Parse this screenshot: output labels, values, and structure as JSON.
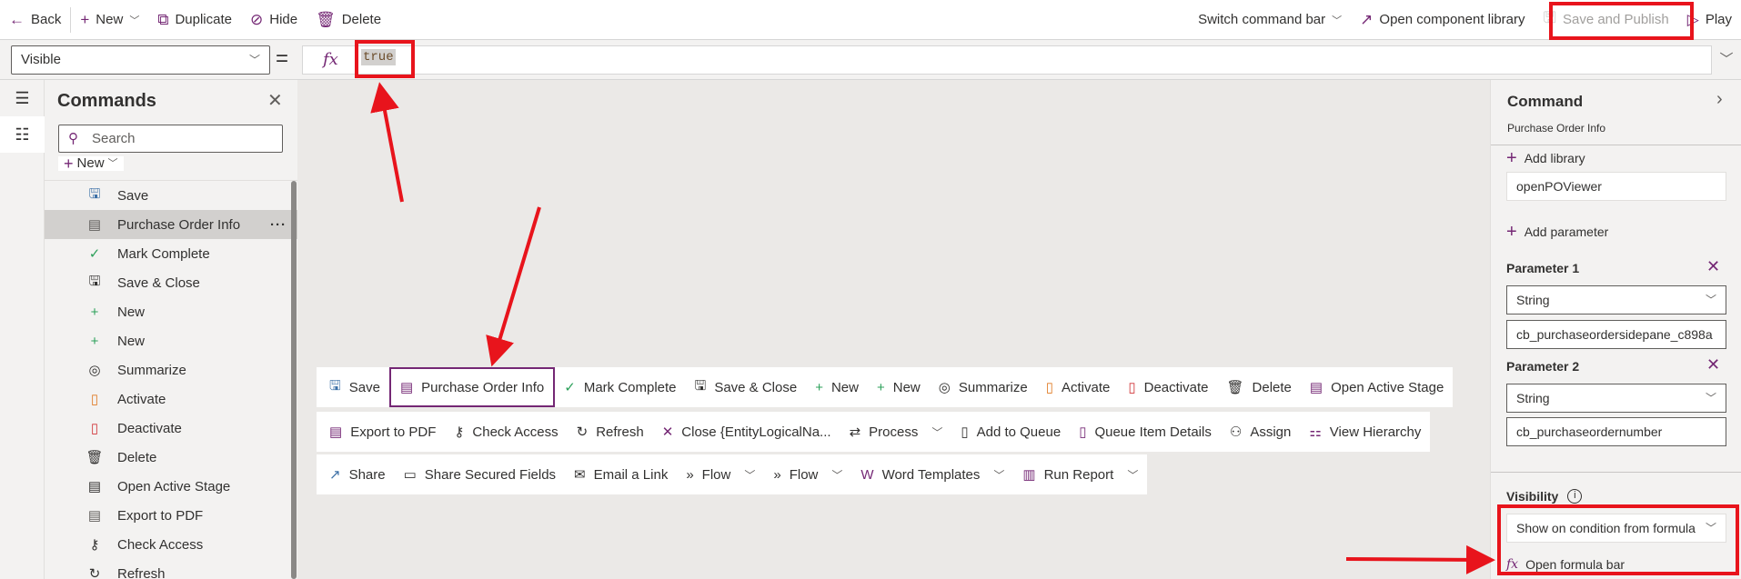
{
  "toolbar": {
    "left": [
      {
        "label": "Back",
        "icon": "back-arrow-icon",
        "glyph": "←"
      },
      {
        "label": "New",
        "icon": "plus-icon",
        "glyph": "+",
        "dropdown": true
      },
      {
        "label": "Duplicate",
        "icon": "duplicate-icon",
        "glyph": "⧉"
      },
      {
        "label": "Hide",
        "icon": "hide-eye-icon",
        "glyph": "⊘"
      },
      {
        "label": "Delete",
        "icon": "trash-icon",
        "glyph": "🗑"
      }
    ],
    "right": [
      {
        "label": "Switch command bar",
        "dropdown": true
      },
      {
        "label": "Open component library",
        "icon": "open-external-icon",
        "glyph": "↗"
      },
      {
        "label": "Save and Publish",
        "icon": "save-icon",
        "glyph": "🖫",
        "disabled": true
      },
      {
        "label": "Play",
        "icon": "play-icon",
        "glyph": "▷"
      }
    ]
  },
  "formula_bar": {
    "property": "Visible",
    "equals": "=",
    "fx": "fx",
    "value": "true"
  },
  "commands_panel": {
    "title": "Commands",
    "search_placeholder": "Search",
    "new_label": "New",
    "items": [
      {
        "label": "Save",
        "icon": "save-icon",
        "glyph": "🖫",
        "color": "#3b6fa6"
      },
      {
        "label": "Purchase Order Info",
        "icon": "pdf-icon",
        "glyph": "▤",
        "color": "#605e5c",
        "selected": true
      },
      {
        "label": "Mark Complete",
        "icon": "checkmark-icon",
        "glyph": "✓",
        "color": "#2ca05a"
      },
      {
        "label": "Save & Close",
        "icon": "save-close-icon",
        "glyph": "🖫",
        "color": "#323130"
      },
      {
        "label": "New",
        "icon": "plus-icon",
        "glyph": "+",
        "color": "#2ca05a"
      },
      {
        "label": "New",
        "icon": "plus-icon",
        "glyph": "+",
        "color": "#2ca05a"
      },
      {
        "label": "Summarize",
        "icon": "copilot-icon",
        "glyph": "◎",
        "color": "#323130"
      },
      {
        "label": "Activate",
        "icon": "activate-icon",
        "glyph": "▯",
        "color": "#e07b24"
      },
      {
        "label": "Deactivate",
        "icon": "deactivate-icon",
        "glyph": "▯",
        "color": "#d13438"
      },
      {
        "label": "Delete",
        "icon": "trash-icon",
        "glyph": "🗑",
        "color": "#323130"
      },
      {
        "label": "Open Active Stage",
        "icon": "stage-icon",
        "glyph": "▤",
        "color": "#323130"
      },
      {
        "label": "Export to PDF",
        "icon": "pdf-icon",
        "glyph": "▤",
        "color": "#605e5c"
      },
      {
        "label": "Check Access",
        "icon": "key-icon",
        "glyph": "⚷",
        "color": "#323130"
      },
      {
        "label": "Refresh",
        "icon": "refresh-icon",
        "glyph": "↻",
        "color": "#323130"
      }
    ]
  },
  "command_bar_preview": [
    [
      {
        "label": "Save",
        "icon": "save-icon",
        "glyph": "🖫",
        "color": "#3b6fa6"
      },
      {
        "label": "Purchase Order Info",
        "icon": "pdf-icon",
        "glyph": "▤",
        "color": "#742774",
        "selected": true
      },
      {
        "label": "Mark Complete",
        "icon": "checkmark-icon",
        "glyph": "✓",
        "color": "#2ca05a"
      },
      {
        "label": "Save & Close",
        "icon": "save-close-icon",
        "glyph": "🖫",
        "color": "#323130"
      },
      {
        "label": "New",
        "icon": "plus-icon",
        "glyph": "+",
        "color": "#2ca05a"
      },
      {
        "label": "New",
        "icon": "plus-icon",
        "glyph": "+",
        "color": "#2ca05a"
      },
      {
        "label": "Summarize",
        "icon": "copilot-icon",
        "glyph": "◎",
        "color": "#323130"
      },
      {
        "label": "Activate",
        "icon": "activate-icon",
        "glyph": "▯",
        "color": "#e07b24"
      },
      {
        "label": "Deactivate",
        "icon": "deactivate-icon",
        "glyph": "▯",
        "color": "#d13438"
      },
      {
        "label": "Delete",
        "icon": "trash-icon",
        "glyph": "🗑",
        "color": "#323130"
      },
      {
        "label": "Open Active Stage",
        "icon": "stage-icon",
        "glyph": "▤",
        "color": "#742774"
      }
    ],
    [
      {
        "label": "Export to PDF",
        "icon": "pdf-icon",
        "glyph": "▤",
        "color": "#742774"
      },
      {
        "label": "Check Access",
        "icon": "key-icon",
        "glyph": "⚷",
        "color": "#323130"
      },
      {
        "label": "Refresh",
        "icon": "refresh-icon",
        "glyph": "↻",
        "color": "#323130"
      },
      {
        "label": "Close {EntityLogicalNa...",
        "icon": "close-icon",
        "glyph": "✕",
        "color": "#742774"
      },
      {
        "label": "Process",
        "icon": "process-icon",
        "glyph": "⇄",
        "color": "#323130",
        "dropdown": true
      },
      {
        "label": "Add to Queue",
        "icon": "add-queue-icon",
        "glyph": "▯",
        "color": "#323130"
      },
      {
        "label": "Queue Item Details",
        "icon": "queue-details-icon",
        "glyph": "▯",
        "color": "#742774"
      },
      {
        "label": "Assign",
        "icon": "assign-icon",
        "glyph": "⚇",
        "color": "#323130"
      },
      {
        "label": "View Hierarchy",
        "icon": "hierarchy-icon",
        "glyph": "⚏",
        "color": "#742774"
      }
    ],
    [
      {
        "label": "Share",
        "icon": "share-icon",
        "glyph": "↗",
        "color": "#3b6fa6"
      },
      {
        "label": "Share Secured Fields",
        "icon": "secured-fields-icon",
        "glyph": "▭",
        "color": "#323130"
      },
      {
        "label": "Email a Link",
        "icon": "email-icon",
        "glyph": "✉",
        "color": "#323130"
      },
      {
        "label": "Flow",
        "icon": "flow-icon",
        "glyph": "»",
        "color": "#323130",
        "dropdown": true
      },
      {
        "label": "Flow",
        "icon": "flow-icon",
        "glyph": "»",
        "color": "#323130",
        "dropdown": true
      },
      {
        "label": "Word Templates",
        "icon": "word-icon",
        "glyph": "W",
        "color": "#742774",
        "dropdown": true
      },
      {
        "label": "Run Report",
        "icon": "report-icon",
        "glyph": "▥",
        "color": "#742774",
        "dropdown": true
      }
    ]
  ],
  "properties_panel": {
    "title": "Command",
    "subtitle": "Purchase Order Info",
    "add_library": "Add library",
    "function_name": "openPOViewer",
    "add_parameter": "Add parameter",
    "parameters": [
      {
        "label": "Parameter 1",
        "type": "String",
        "value": "cb_purchaseordersidepane_c898a"
      },
      {
        "label": "Parameter 2",
        "type": "String",
        "value": "cb_purchaseordernumber"
      }
    ],
    "visibility_label": "Visibility",
    "visibility_value": "Show on condition from formula",
    "open_formula_bar": "Open formula bar"
  },
  "colors": {
    "accent": "#742774",
    "annotation": "#e8141c"
  }
}
